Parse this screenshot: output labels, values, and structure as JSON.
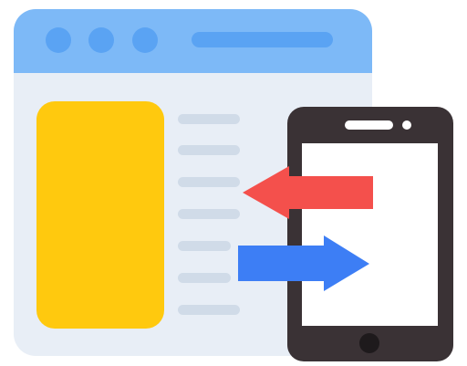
{
  "illustration": {
    "icons": {
      "browser": "browser-window-icon",
      "window_controls": [
        "window-dot-icon",
        "window-dot-icon",
        "window-dot-icon"
      ],
      "address_bar": "address-bar-icon",
      "content_card": "content-card-icon",
      "text_lines": "text-line-icon",
      "tablet": "tablet-device-icon",
      "speaker": "speaker-slot-icon",
      "camera": "front-camera-icon",
      "home_button": "home-button-icon",
      "arrow_left": "arrow-left-icon",
      "arrow_right": "arrow-right-icon"
    },
    "colors": {
      "browser_titlebar": "#7DB9F7",
      "window_dots": "#5AA3F3",
      "address_bar": "#5AA3F3",
      "browser_body": "#E8EEF6",
      "content_card": "#FFC90E",
      "text_lines": "#D0DBE8",
      "tablet_body": "#3A3235",
      "tablet_screen": "#FFFFFF",
      "arrow_left": "#F4504C",
      "arrow_right": "#3D7EF5"
    }
  }
}
